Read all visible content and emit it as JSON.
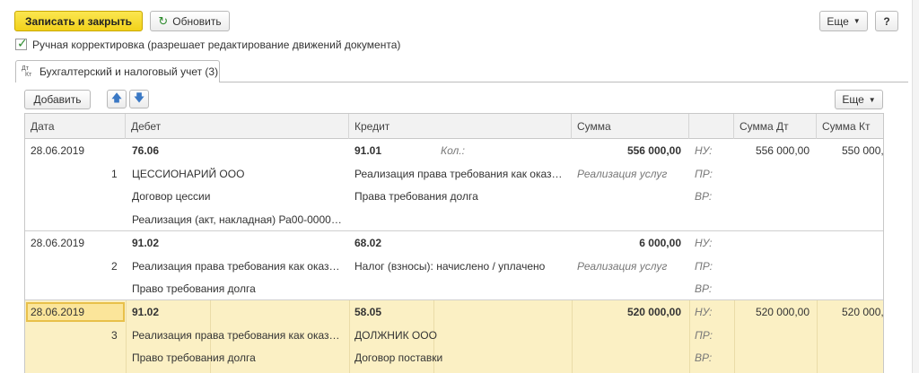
{
  "toolbar": {
    "save_close_label": "Записать и закрыть",
    "refresh_label": "Обновить",
    "more_label": "Еще",
    "help_label": "?"
  },
  "manual_edit": {
    "checked": true,
    "label": "Ручная корректировка (разрешает редактирование движений документа)"
  },
  "tab": {
    "icon_top": "Дт",
    "icon_bottom": "Кт",
    "label": "Бухгалтерский и налоговый учет (3)"
  },
  "table_toolbar": {
    "add_label": "Добавить",
    "up_arrow": "🡅",
    "down_arrow": "🡇",
    "more_label": "Еще"
  },
  "table": {
    "headers": {
      "date": "Дата",
      "debit": "Дебет",
      "credit": "Кредит",
      "sum": "Сумма",
      "blank": "",
      "sum_dt": "Сумма Дт",
      "sum_kt": "Сумма Кт"
    },
    "rows": [
      {
        "date": "28.06.2019",
        "num": "1",
        "debit_account": "76.06",
        "debit_sub1": "ЦЕССИОНАРИЙ ООО",
        "debit_sub2": "Договор цессии",
        "debit_sub3": "Реализация (акт, накладная) Ра00-000013...",
        "credit_account": "91.01",
        "qty_label": "Кол.:",
        "credit_sub1": "Реализация права требования как оказан...",
        "credit_sub2": "Права требования долга",
        "sum": "556 000,00",
        "sum_note": "Реализация услуг",
        "nu": "НУ:",
        "pr": "ПР:",
        "vr": "ВР:",
        "sum_dt": "556 000,00",
        "sum_kt": "550 000,"
      },
      {
        "date": "28.06.2019",
        "num": "2",
        "debit_account": "91.02",
        "debit_sub1": "Реализация права требования как оказан...",
        "debit_sub2": "Право требования долга",
        "credit_account": "68.02",
        "credit_sub1": "Налог (взносы): начислено / уплачено",
        "sum": "6 000,00",
        "sum_note": "Реализация услуг",
        "nu": "НУ:",
        "pr": "ПР:",
        "vr": "ВР:"
      },
      {
        "date": "28.06.2019",
        "num": "3",
        "debit_account": "91.02",
        "debit_sub1": "Реализация права требования как оказан...",
        "debit_sub2": "Право требования долга",
        "credit_account": "58.05",
        "credit_sub1": "ДОЛЖНИК ООО",
        "credit_sub2": "Договор поставки",
        "sum": "520 000,00",
        "nu": "НУ:",
        "pr": "ПР:",
        "vr": "ВР:",
        "sum_dt": "520 000,00",
        "sum_kt": "520 000,"
      }
    ]
  },
  "colors": {
    "primary_button": "#f2d21a",
    "selected_row": "#fbf0c4",
    "arrow": "#3a78c4",
    "checkmark": "#2e8b2e"
  }
}
